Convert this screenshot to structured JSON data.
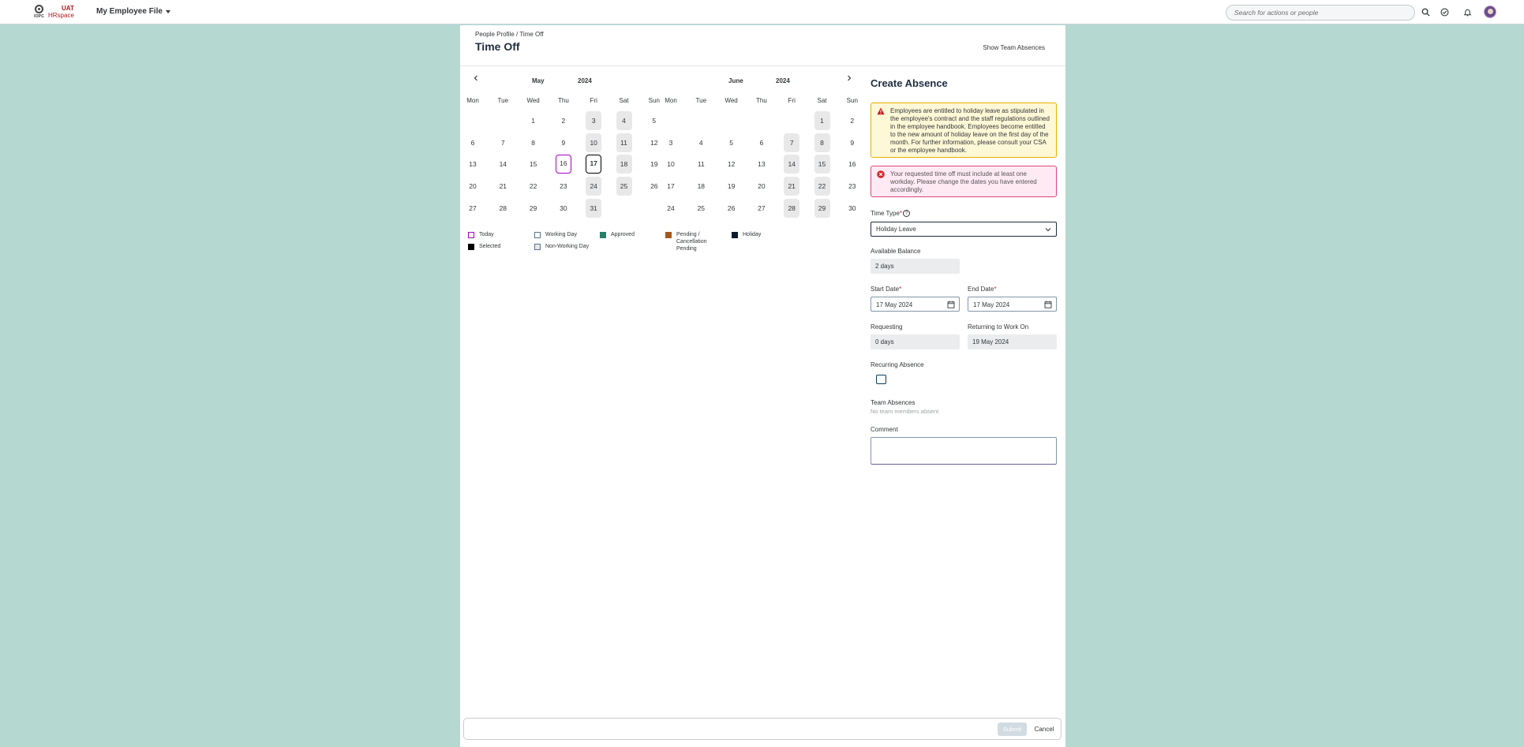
{
  "shell": {
    "logo_org": "IOPC",
    "logo_uat": "UAT",
    "logo_brand": "HRspace",
    "app_title": "My Employee File",
    "search_placeholder": "Search for actions or people"
  },
  "page": {
    "breadcrumb": "People Profile / Time Off",
    "title": "Time Off",
    "show_team_absences": "Show Team Absences"
  },
  "calendar": {
    "weekday_headers": [
      "Mon",
      "Tue",
      "Wed",
      "Thu",
      "Fri",
      "Sat",
      "Sun"
    ],
    "left": {
      "month": "May",
      "year": "2024"
    },
    "right": {
      "month": "June",
      "year": "2024"
    },
    "may_days": [
      [
        "",
        "",
        "1",
        "2",
        "3",
        "4",
        "5"
      ],
      [
        "6",
        "7",
        "8",
        "9",
        "10",
        "11",
        "12"
      ],
      [
        "13",
        "14",
        "15",
        "16",
        "17",
        "18",
        "19"
      ],
      [
        "20",
        "21",
        "22",
        "23",
        "24",
        "25",
        "26"
      ],
      [
        "27",
        "28",
        "29",
        "30",
        "31",
        "",
        ""
      ]
    ],
    "june_days": [
      [
        "",
        "",
        "",
        "",
        "",
        "1",
        "2"
      ],
      [
        "3",
        "4",
        "5",
        "6",
        "7",
        "8",
        "9"
      ],
      [
        "10",
        "11",
        "12",
        "13",
        "14",
        "15",
        "16"
      ],
      [
        "17",
        "18",
        "19",
        "20",
        "21",
        "22",
        "23"
      ],
      [
        "24",
        "25",
        "26",
        "27",
        "28",
        "29",
        "30"
      ]
    ],
    "today": "16",
    "selected": "17",
    "legend": [
      {
        "label": "Today",
        "color": "#a500c4",
        "style": "outline"
      },
      {
        "label": "Working Day",
        "color": "#5b738b",
        "style": "outline"
      },
      {
        "label": "Approved",
        "color": "#2b7d6b",
        "style": "fill"
      },
      {
        "label": "Pending / Cancellation Pending",
        "color": "#a45a1e",
        "style": "fill"
      },
      {
        "label": "Holiday",
        "color": "#0a1b2e",
        "style": "fill"
      },
      {
        "label": "Selected",
        "color": "#000000",
        "style": "fill"
      },
      {
        "label": "Non-Working Day",
        "color": "#5b738b",
        "style": "outline-grey"
      }
    ]
  },
  "form": {
    "title": "Create Absence",
    "warning_text": "Employees are entitled to holiday leave as stipulated in the employee's contract and the staff regulations outlined in the employee handbook. Employees become entitled to the new amount of holiday leave on the first day of the month. For further information, please consult your CSA or the employee handbook.",
    "error_text": "Your requested time off must include at least one workday. Please change the dates you have entered accordingly.",
    "time_type_label": "Time Type",
    "time_type_value": "Holiday Leave",
    "available_balance_label": "Available Balance",
    "available_balance_value": "2 days",
    "start_date_label": "Start Date",
    "start_date_value": "17 May 2024",
    "end_date_label": "End Date",
    "end_date_value": "17 May 2024",
    "requesting_label": "Requesting",
    "requesting_value": "0 days",
    "returning_label": "Returning to Work On",
    "returning_value": "19 May 2024",
    "recurring_label": "Recurring Absence",
    "recurring_checked": false,
    "team_absences_label": "Team Absences",
    "team_absences_value": "No team members absent",
    "comment_label": "Comment",
    "comment_value": "",
    "required_marker": "*",
    "help_marker": "?"
  },
  "footer": {
    "submit": "Submit",
    "cancel": "Cancel"
  },
  "colors": {
    "background": "#b5d8d1",
    "today_outline": "#a500c4",
    "warning_border": "#e9b000",
    "error_border": "#e0457b",
    "brand_red": "#b0171c"
  }
}
